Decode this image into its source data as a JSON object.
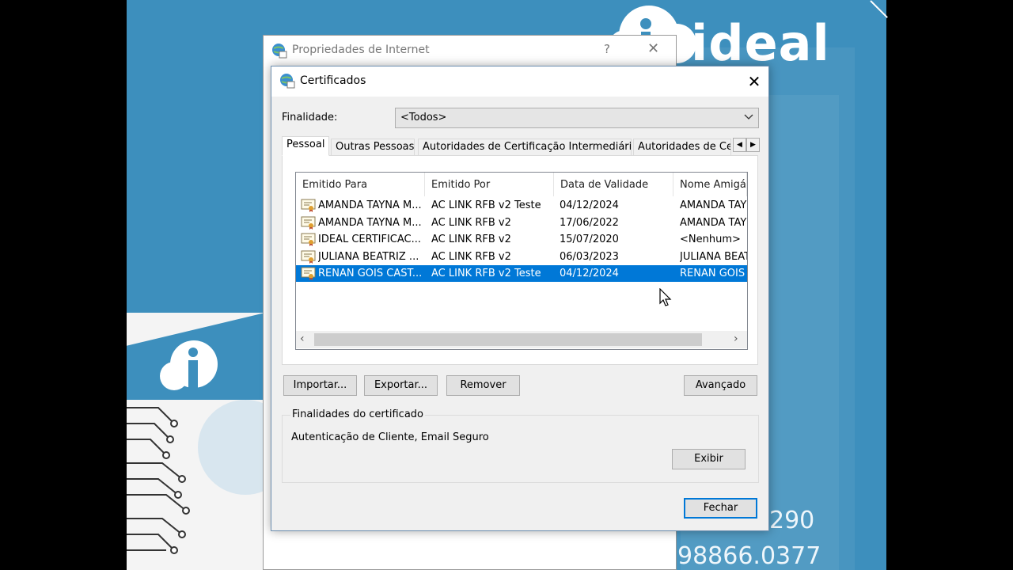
{
  "background": {
    "brand_name": "ideal",
    "phone_1": "290",
    "phone_2": "98866.0377"
  },
  "back_window": {
    "title": "Propriedades de Internet",
    "help_label": "?",
    "close_label": "✕"
  },
  "dialog": {
    "title": "Certificados",
    "close_label": "✕",
    "purpose_label": "Finalidade:",
    "purpose_value": "<Todos>",
    "tabs": [
      {
        "label": "Pessoal",
        "active": true
      },
      {
        "label": "Outras Pessoas",
        "active": false
      },
      {
        "label": "Autoridades de Certificação Intermediárias",
        "active": false
      },
      {
        "label": "Autoridades de Ce",
        "active": false
      }
    ],
    "columns": [
      "Emitido Para",
      "Emitido Por",
      "Data de Validade",
      "Nome Amigáve"
    ],
    "rows": [
      {
        "issued_to": "AMANDA TAYNA M...",
        "issued_by": "AC LINK RFB v2 Teste",
        "expiry": "04/12/2024",
        "friendly": "AMANDA TAYNA",
        "selected": false
      },
      {
        "issued_to": "AMANDA TAYNA M...",
        "issued_by": "AC LINK RFB v2",
        "expiry": "17/06/2022",
        "friendly": "AMANDA TAYN",
        "selected": false
      },
      {
        "issued_to": "IDEAL CERTIFICAC...",
        "issued_by": "AC LINK RFB v2",
        "expiry": "15/07/2020",
        "friendly": "<Nenhum>",
        "selected": false
      },
      {
        "issued_to": "JULIANA BEATRIZ ...",
        "issued_by": "AC LINK RFB v2",
        "expiry": "06/03/2023",
        "friendly": "JULIANA BEAT",
        "selected": false
      },
      {
        "issued_to": "RENAN GOIS CAST...",
        "issued_by": "AC LINK RFB v2 Teste",
        "expiry": "04/12/2024",
        "friendly": "RENAN GOIS C",
        "selected": true
      }
    ],
    "buttons": {
      "import": "Importar...",
      "export": "Exportar...",
      "remove": "Remover",
      "advanced": "Avançado",
      "view": "Exibir",
      "close": "Fechar"
    },
    "purposes_group_title": "Finalidades do certificado",
    "purposes_text": "Autenticação de Cliente, Email Seguro"
  },
  "colors": {
    "wallpaper": "#3d8fbd",
    "selection": "#0078d7",
    "dialog_bg": "#f0f0f0"
  },
  "icons": [
    "globe-certificate-icon",
    "certificate-icon",
    "chevron-down-icon",
    "close-icon",
    "mouse-cursor-icon"
  ]
}
